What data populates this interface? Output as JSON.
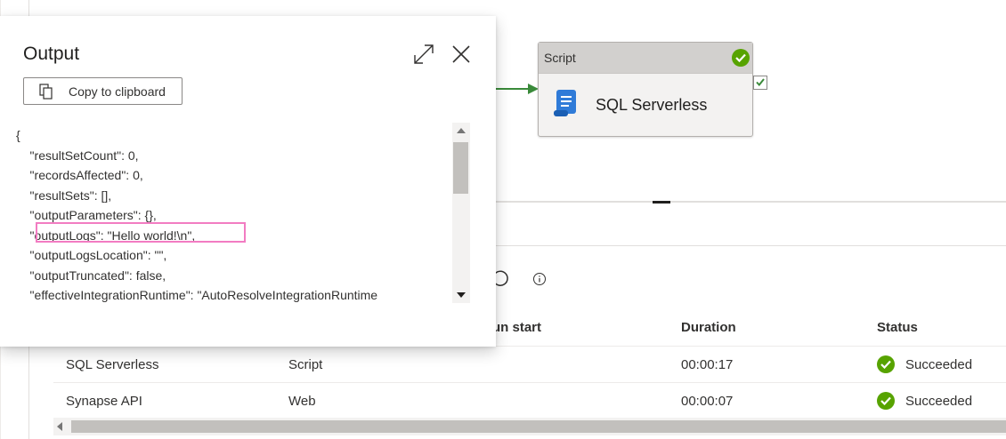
{
  "canvas": {
    "activity": {
      "type_label": "Script",
      "name": "SQL Serverless",
      "status_color": "#57a300",
      "icon": "script-icon"
    },
    "connector_color": "#3a8a3a"
  },
  "grid": {
    "headers": [
      "un start",
      "Duration",
      "Status"
    ],
    "rows": [
      {
        "name": "SQL Serverless",
        "type": "Script",
        "duration": "00:00:17",
        "status": "Succeeded"
      },
      {
        "name": "Synapse API",
        "type": "Web",
        "duration": "00:00:07",
        "status": "Succeeded"
      }
    ],
    "status_color": "#57a300"
  },
  "output_panel": {
    "title": "Output",
    "copy_label": "Copy to clipboard",
    "highlight_color": "#f27cc2",
    "lines": [
      "{",
      "    \"resultSetCount\": 0,",
      "    \"recordsAffected\": 0,",
      "    \"resultSets\": [],",
      "    \"outputParameters\": {},",
      "    \"outputLogs\": \"Hello world!\\n\",",
      "    \"outputLogsLocation\": \"\",",
      "    \"outputTruncated\": false,",
      "    \"effectiveIntegrationRuntime\": \"AutoResolveIntegrationRuntime"
    ]
  }
}
